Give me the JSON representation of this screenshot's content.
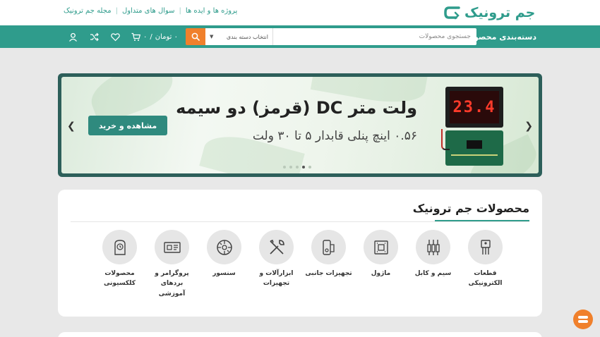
{
  "header": {
    "logo_text": "جم ترونیک",
    "top_links": [
      "مجله جم ترونیک",
      "سوال های متداول",
      "پروژه ها و ایده ها"
    ]
  },
  "nav": {
    "categories_label": "دسته‌بندی محصولات",
    "search_placeholder": "جستجوی محصولات",
    "category_select": "انتخاب دسته بندی",
    "cart_total": "۰ تومان",
    "cart_count": "۰"
  },
  "banner": {
    "title": "ولت متر DC (قرمز) دو سیمه",
    "subtitle": "۰.۵۶ اینچ پنلی قابدار ۵ تا ۳۰ ولت",
    "cta": "مشاهده و خرید",
    "meter_reading": "23.4",
    "slide_count": 5,
    "active_slide": 4
  },
  "products": {
    "title": "محصولات جم ترونیک",
    "categories": [
      {
        "label": "قطعات الکترونیکی",
        "icon": "transistor-icon"
      },
      {
        "label": "سیم و کابل",
        "icon": "wire-icon"
      },
      {
        "label": "ماژول",
        "icon": "module-icon"
      },
      {
        "label": "تجهیزات جانبی",
        "icon": "accessory-icon"
      },
      {
        "label": "ابزارآلات و تجهیزات",
        "icon": "tools-icon"
      },
      {
        "label": "سنسور",
        "icon": "sensor-icon"
      },
      {
        "label": "پروگرامر و بردهای آموزشی",
        "icon": "board-icon"
      },
      {
        "label": "محصولات کلکسیونی",
        "icon": "collectible-icon"
      }
    ]
  },
  "colors": {
    "primary": "#2f9c8c",
    "accent": "#f0802c",
    "banner_frame": "#2d5f5a"
  }
}
